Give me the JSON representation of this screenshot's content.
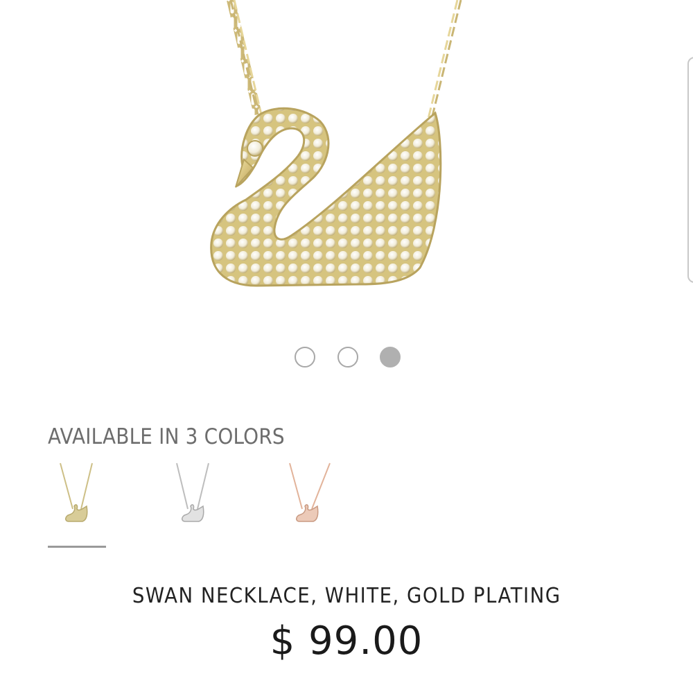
{
  "product_image": {
    "icon": "swan-necklace-image",
    "colors": {
      "gold": "#d9c98a",
      "crystal": "#f7f3e6"
    }
  },
  "carousel": {
    "count": 3,
    "active_index": 2
  },
  "colors_section": {
    "heading": "AVAILABLE IN 3 COLORS",
    "swatches": [
      {
        "name": "gold",
        "color": "#cdbf86",
        "selected": true
      },
      {
        "name": "silver",
        "color": "#c9c9c9",
        "selected": false
      },
      {
        "name": "rose-gold",
        "color": "#e2b39a",
        "selected": false
      }
    ]
  },
  "product": {
    "name": "SWAN NECKLACE, WHITE, GOLD PLATING",
    "price": "$ 99.00"
  }
}
